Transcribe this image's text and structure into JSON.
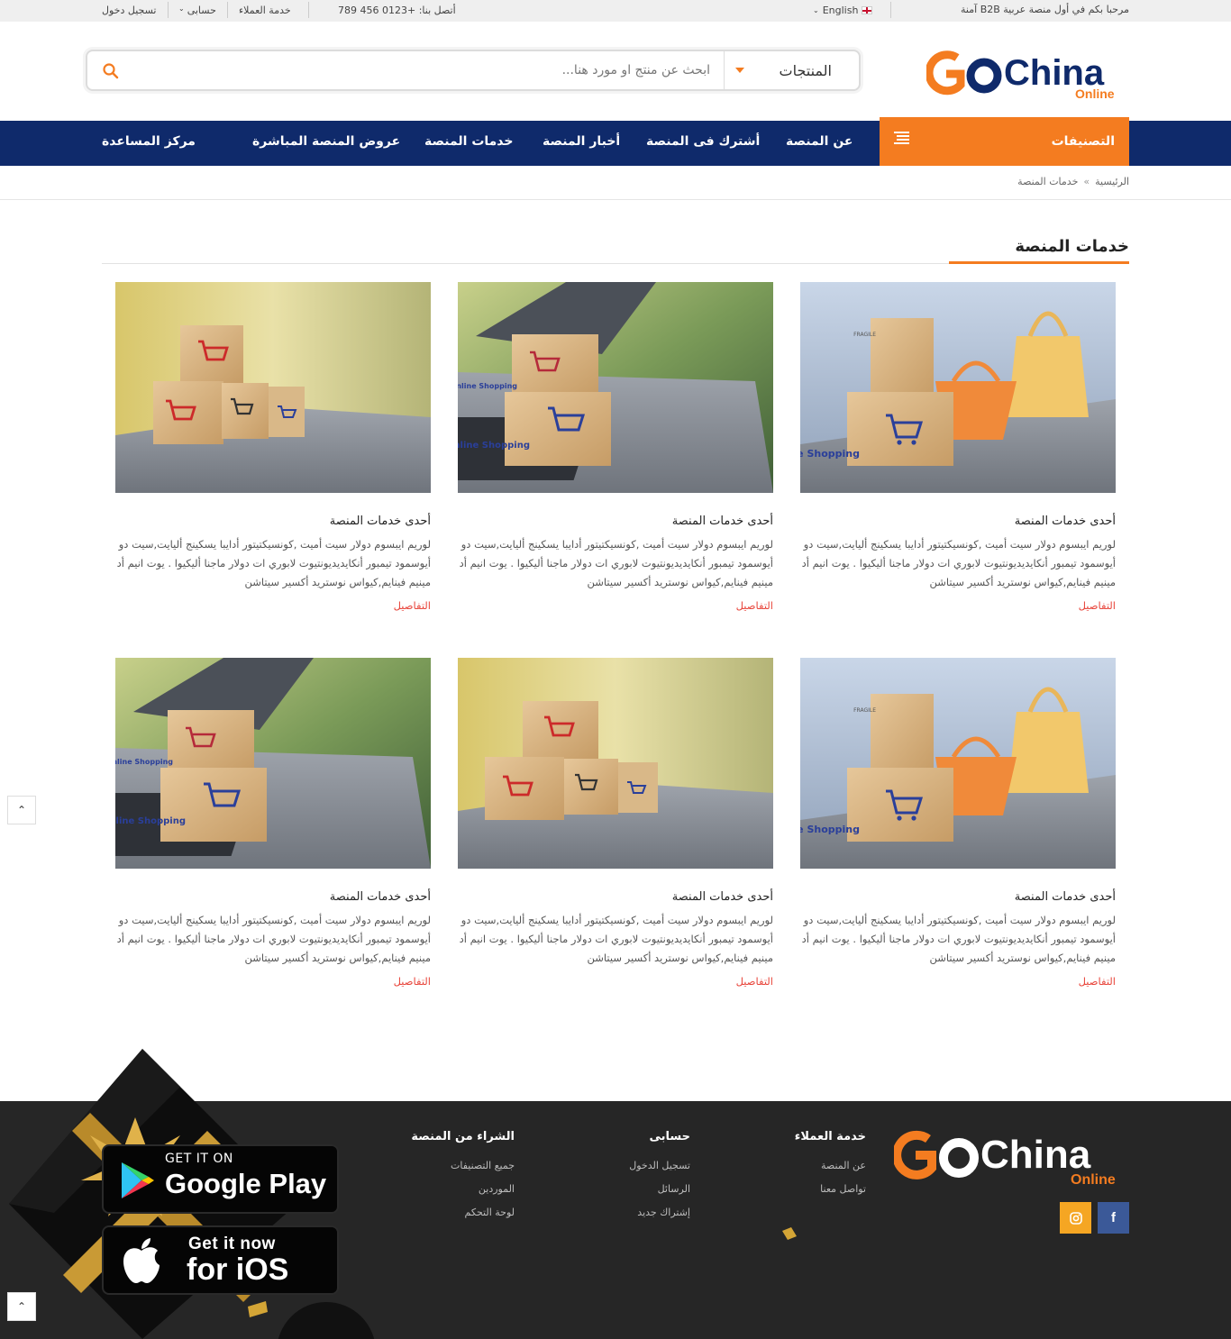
{
  "topbar": {
    "welcome": "مرحبا بكم في أول منصة عربية B2B آمنة",
    "language": "English",
    "phone": "أتصل بنا: +0123 456 789",
    "customer_service": "خدمة العملاء",
    "account": "حسابى",
    "login": "تسجيل دخول"
  },
  "header": {
    "logo_main": "China",
    "logo_go": "GO",
    "logo_sub": "Online",
    "search_category": "المنتجات",
    "search_placeholder": "ابحث عن منتج او مورد هنا..."
  },
  "nav": {
    "categories": "التصنيفات",
    "items": [
      "عن المنصة",
      "أشترك فى المنصة",
      "أخبار المنصة",
      "خدمات المنصة",
      "عروض المنصة المباشرة",
      "مركز المساعدة"
    ]
  },
  "breadcrumb": {
    "home": "الرئيسية",
    "sep": "»",
    "current": "خدمات المنصة"
  },
  "section": {
    "title": "خدمات المنصة"
  },
  "cards": [
    {
      "title": "أحدى خدمات المنصة",
      "desc": "لوريم ايبسوم دولار سيت أميت ,كونسيكتيتور أدايبا يسكينج أليايت,سيت دو أيوسمود تيمبور أنكايديديونتيوت لابوري ات دولار ماجنا أليكيوا . يوت انيم أد مينيم فينايم,كيواس نوستريد أكسير سيتاشن",
      "more": "التفاصيل",
      "image": "online-shopping-bag-basket"
    },
    {
      "title": "أحدى خدمات المنصة",
      "desc": "لوريم ايبسوم دولار سيت أميت ,كونسيكتيتور أدايبا يسكينج أليايت,سيت دو أيوسمود تيمبور أنكايديديونتيوت لابوري ات دولار ماجنا أليكيوا . يوت انيم أد مينيم فينايم,كيواس نوستريد أكسير سيتاشن",
      "more": "التفاصيل",
      "image": "online-shopping-laptop-boxes"
    },
    {
      "title": "أحدى خدمات المنصة",
      "desc": "لوريم ايبسوم دولار سيت أميت ,كونسيكتيتور أدايبا يسكينج أليايت,سيت دو أيوسمود تيمبور أنكايديديونتيوت لابوري ات دولار ماجنا أليكيوا . يوت انيم أد مينيم فينايم,كيواس نوستريد أكسير سيتاشن",
      "more": "التفاصيل",
      "image": "cart-boxes-stack"
    },
    {
      "title": "أحدى خدمات المنصة",
      "desc": "لوريم ايبسوم دولار سيت أميت ,كونسيكتيتور أدايبا يسكينج أليايت,سيت دو أيوسمود تيمبور أنكايديديونتيوت لابوري ات دولار ماجنا أليكيوا . يوت انيم أد مينيم فينايم,كيواس نوستريد أكسير سيتاشن",
      "more": "التفاصيل",
      "image": "online-shopping-bag-basket"
    },
    {
      "title": "أحدى خدمات المنصة",
      "desc": "لوريم ايبسوم دولار سيت أميت ,كونسيكتيتور أدايبا يسكينج أليايت,سيت دو أيوسمود تيمبور أنكايديديونتيوت لابوري ات دولار ماجنا أليكيوا . يوت انيم أد مينيم فينايم,كيواس نوستريد أكسير سيتاشن",
      "more": "التفاصيل",
      "image": "cart-boxes-stack"
    },
    {
      "title": "أحدى خدمات المنصة",
      "desc": "لوريم ايبسوم دولار سيت أميت ,كونسيكتيتور أدايبا يسكينج أليايت,سيت دو أيوسمود تيمبور أنكايديديونتيوت لابوري ات دولار ماجنا أليكيوا . يوت انيم أد مينيم فينايم,كيواس نوستريد أكسير سيتاشن",
      "more": "التفاصيل",
      "image": "online-shopping-laptop-boxes"
    }
  ],
  "image_text": {
    "online_shopping": "Online Shopping",
    "fragile": "FRAGILE"
  },
  "footer": {
    "col1": {
      "title": "خدمة العملاء",
      "links": [
        "عن المنصة",
        "تواصل معنا"
      ]
    },
    "col2": {
      "title": "حسابى",
      "links": [
        "تسجيل الدخول",
        "الرسائل",
        "إشتراك جديد"
      ]
    },
    "col3": {
      "title": "الشراء من المنصة",
      "links": [
        "جميع التصنيفات",
        "الموردين",
        "لوحة التحكم"
      ]
    },
    "google_line1": "GET IT ON",
    "google_line2": "Google Play",
    "ios_line1": "Get it now",
    "ios_line2": "for iOS",
    "social": [
      "facebook-icon",
      "instagram-icon"
    ]
  },
  "colors": {
    "navy": "#0f2a6b",
    "orange": "#f47c20",
    "link_red": "#e8443a",
    "footer_bg": "#262626"
  }
}
